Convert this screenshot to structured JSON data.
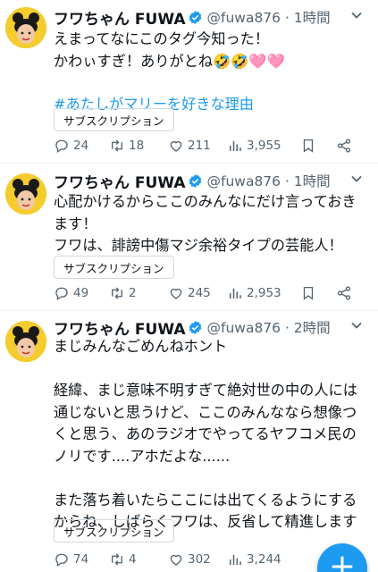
{
  "icons": {
    "verified": "verified-badge-icon",
    "caret": "chevron-down-icon",
    "reply": "reply-icon",
    "retweet": "retweet-icon",
    "like": "heart-icon",
    "views": "views-icon",
    "bookmark": "bookmark-icon",
    "share": "share-icon",
    "compose": "plus-icon"
  },
  "colors": {
    "accent": "#1d9bf0",
    "text": "#0f1419",
    "muted": "#536471"
  },
  "tweets": [
    {
      "name": "フワちゃん FUWA",
      "handle": "@fuwa876 · 1時間",
      "lines": "えまってなにこのタグ今知った！\nかわぃすぎ！ありがとね🤣🤣🩷🩷",
      "hashtag": "#あたしがマリーを好きな理由",
      "subscription": "サブスクリプション",
      "replies": "24",
      "retweets": "18",
      "likes": "211",
      "views": "3,955"
    },
    {
      "name": "フワちゃん FUWA",
      "handle": "@fuwa876 · 1時間",
      "lines": "心配かけるからここのみんなにだけ言っておき\nます！\nフワは、誹謗中傷マジ余裕タイプの芸能人！",
      "subscription": "サブスクリプション",
      "replies": "49",
      "retweets": "2",
      "likes": "245",
      "views": "2,953"
    },
    {
      "name": "フワちゃん FUWA",
      "handle": "@fuwa876 · 2時間",
      "lines": "まじみんなごめんねホント\n\n経緯、まじ意味不明すぎて絶対世の中の人には\n通じないと思うけど、ここのみんななら想像つ\nくと思う、あのラジオでやってるヤフコメ民の\nノリです....アホだよな......\n\nまた落ち着いたらここには出てくるようにする\nからね、しばらくフワは、反省して精進します",
      "subscription": "サブスクリプション",
      "replies": "74",
      "retweets": "4",
      "likes": "302",
      "views": "3,244"
    }
  ],
  "fab": {
    "label": "+"
  }
}
